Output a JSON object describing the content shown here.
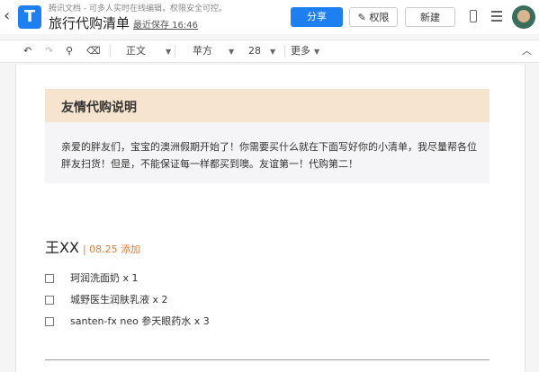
{
  "header": {
    "app_subtitle": "腾讯文档 - 可多人实时在线编辑，权限安全可控。",
    "doc_title": "旅行代购清单",
    "saved_status": "最近保存 16:46",
    "share_label": "分享",
    "permission_label": "权限",
    "new_label": "新建"
  },
  "toolbar": {
    "paragraph_style": "正文",
    "font": "苹方",
    "font_size": "28",
    "more": "更多"
  },
  "notice": {
    "title": "友情代购说明",
    "text": "亲爱的胖友们，宝宝的澳洲假期开始了！你需要买什么就在下面写好你的小清单，我尽量帮各位胖友扫货！但是，不能保证每一样都买到噢。友谊第一！代购第二！"
  },
  "entry": {
    "name": "王XX",
    "date_tag": "| 08.25 添加",
    "items": [
      {
        "text": "珂润洗面奶 x 1",
        "checked": false
      },
      {
        "text": "城野医生润肤乳液 x 2",
        "checked": false
      },
      {
        "text": "santen-fx neo 参天眼药水 x 3",
        "checked": false
      }
    ]
  },
  "colors": {
    "accent": "#1d7ff0",
    "notice_header_bg": "#f7e4cf",
    "date_tag": "#e07b39"
  }
}
